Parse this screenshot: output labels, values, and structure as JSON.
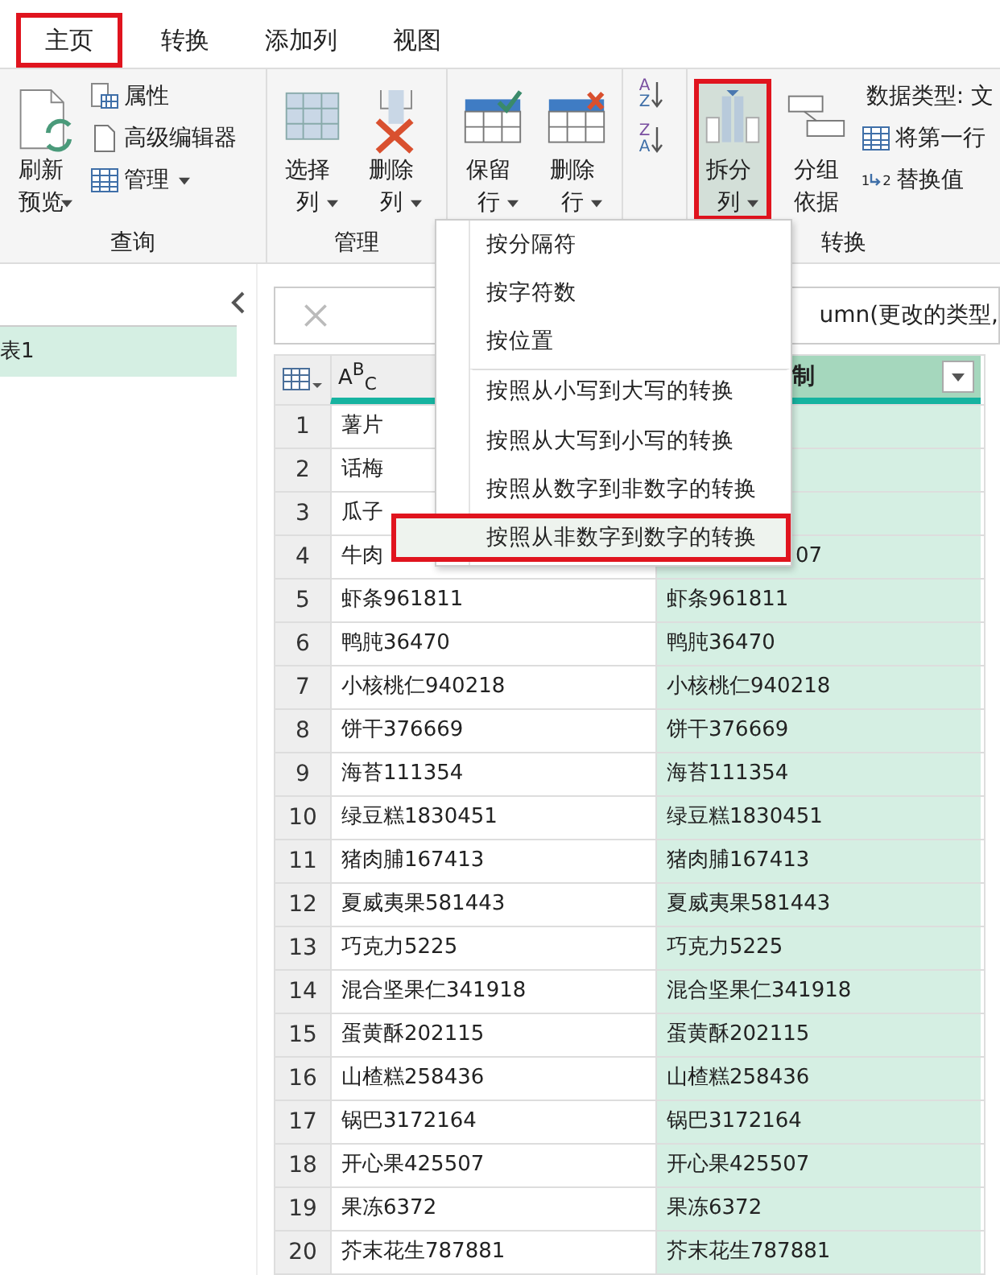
{
  "tabs": [
    {
      "label": "主页",
      "highlighted": true
    },
    {
      "label": "转换",
      "highlighted": false
    },
    {
      "label": "添加列",
      "highlighted": false
    },
    {
      "label": "视图",
      "highlighted": false
    }
  ],
  "ribbon": {
    "groups": [
      {
        "label": "查询",
        "items": [
          {
            "kind": "large",
            "label": "刷新预览",
            "dropdown": true,
            "highlighted": false
          },
          {
            "kind": "stack",
            "entries": [
              {
                "label": "属性",
                "dropdown": false
              },
              {
                "label": "高级编辑器",
                "dropdown": false
              },
              {
                "label": "管理",
                "dropdown": true
              }
            ]
          }
        ]
      },
      {
        "label": "管理",
        "items": [
          {
            "kind": "large",
            "label": "选择列",
            "dropdown": true,
            "highlighted": false
          },
          {
            "kind": "large",
            "label": "删除列",
            "dropdown": true,
            "highlighted": false
          }
        ]
      },
      {
        "items": [
          {
            "kind": "large",
            "label": "保留行",
            "dropdown": true,
            "highlighted": false
          },
          {
            "kind": "large",
            "label": "删除行",
            "dropdown": true,
            "highlighted": false
          }
        ]
      },
      {
        "items": [
          {
            "kind": "sort",
            "buttons": [
              {
                "letters": [
                  "A",
                  "Z"
                ]
              },
              {
                "letters": [
                  "Z",
                  "A"
                ]
              }
            ]
          }
        ]
      },
      {
        "label": "转换",
        "items": [
          {
            "kind": "large",
            "label": "拆分列",
            "dropdown": true,
            "highlighted": true
          },
          {
            "kind": "large",
            "label": "分组依据",
            "dropdown": false,
            "highlighted": false
          },
          {
            "kind": "stack",
            "entries": [
              {
                "label": "数据类型: 文",
                "dropdown": false
              },
              {
                "label": "将第一行",
                "dropdown": false
              },
              {
                "label": "替换值",
                "dropdown": false,
                "icon_text": [
                  "1",
                  "2"
                ]
              }
            ]
          }
        ]
      }
    ]
  },
  "queries": [
    {
      "label": "表1",
      "selected": true
    }
  ],
  "formula": {
    "text": "umn(更改的类型,"
  },
  "table": {
    "columns": [
      {
        "type_label": "A$^{B}$$_{C}$",
        "selected": false
      },
      {
        "title": "制",
        "selected": true
      }
    ],
    "rows": [
      {
        "index": "1",
        "cells": [
          "薯片"
        ]
      },
      {
        "index": "2",
        "cells": [
          "话梅"
        ]
      },
      {
        "index": "3",
        "cells": [
          "瓜子"
        ]
      },
      {
        "index": "4",
        "cells": [
          "牛肉",
          {
            "text": "07",
            "covered_left": true
          }
        ]
      },
      {
        "index": "5",
        "cells": [
          "虾条961811",
          "虾条961811"
        ]
      },
      {
        "index": "6",
        "cells": [
          "鸭肫36470",
          "鸭肫36470"
        ]
      },
      {
        "index": "7",
        "cells": [
          "小核桃仁940218",
          "小核桃仁940218"
        ]
      },
      {
        "index": "8",
        "cells": [
          "饼干376669",
          "饼干376669"
        ]
      },
      {
        "index": "9",
        "cells": [
          "海苔111354",
          "海苔111354"
        ]
      },
      {
        "index": "10",
        "cells": [
          "绿豆糕1830451",
          "绿豆糕1830451"
        ]
      },
      {
        "index": "11",
        "cells": [
          "猪肉脯167413",
          "猪肉脯167413"
        ]
      },
      {
        "index": "12",
        "cells": [
          "夏威夷果581443",
          "夏威夷果581443"
        ]
      },
      {
        "index": "13",
        "cells": [
          "巧克力5225",
          "巧克力5225"
        ]
      },
      {
        "index": "14",
        "cells": [
          "混合坚果仁341918",
          "混合坚果仁341918"
        ]
      },
      {
        "index": "15",
        "cells": [
          "蛋黄酥202115",
          "蛋黄酥202115"
        ]
      },
      {
        "index": "16",
        "cells": [
          "山楂糕258436",
          "山楂糕258436"
        ]
      },
      {
        "index": "17",
        "cells": [
          "锅巴3172164",
          "锅巴3172164"
        ]
      },
      {
        "index": "18",
        "cells": [
          "开心果425507",
          "开心果425507"
        ]
      },
      {
        "index": "19",
        "cells": [
          "果冻6372",
          "果冻6372"
        ]
      },
      {
        "index": "20",
        "cells": [
          "芥末花生787881",
          "芥末花生787881"
        ]
      }
    ]
  },
  "menu": {
    "items": [
      {
        "label": "按分隔符",
        "separator_before": false,
        "highlighted": false
      },
      {
        "label": "按字符数",
        "separator_before": false,
        "highlighted": false
      },
      {
        "label": "按位置",
        "separator_before": false,
        "highlighted": false
      },
      {
        "label": "按照从小写到大写的转换",
        "separator_before": true,
        "highlighted": false
      },
      {
        "label": "按照从大写到小写的转换",
        "separator_before": false,
        "highlighted": false
      },
      {
        "label": "按照从数字到非数字的转换",
        "separator_before": false,
        "highlighted": false
      },
      {
        "label": "按照从非数字到数字的转换",
        "separator_before": false,
        "highlighted": true
      }
    ]
  }
}
